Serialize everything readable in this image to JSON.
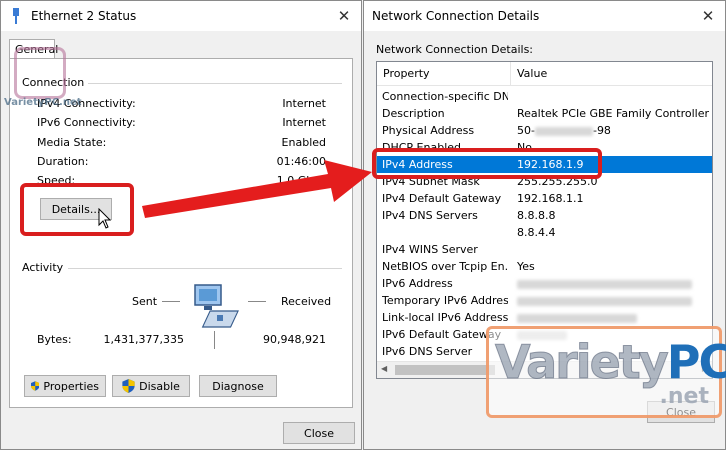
{
  "left_window": {
    "title": "Ethernet 2 Status",
    "tab_general": "General",
    "connection_group": "Connection",
    "rows": [
      {
        "label": "IPv4 Connectivity:",
        "value": "Internet"
      },
      {
        "label": "IPv6 Connectivity:",
        "value": "Internet"
      },
      {
        "label": "Media State:",
        "value": "Enabled"
      },
      {
        "label": "Duration:",
        "value": "01:46:00"
      },
      {
        "label": "Speed:",
        "value": "1.0 Gbps"
      }
    ],
    "details_button": "Details...",
    "activity_group": "Activity",
    "sent_label": "Sent",
    "received_label": "Received",
    "bytes_label": "Bytes:",
    "bytes_sent": "1,431,377,335",
    "bytes_received": "90,948,921",
    "properties_button": "Properties",
    "disable_button": "Disable",
    "diagnose_button": "Diagnose",
    "close_button": "Close"
  },
  "right_window": {
    "title": "Network Connection Details",
    "group_label": "Network Connection Details:",
    "columns": {
      "property": "Property",
      "value": "Value"
    },
    "rows": [
      {
        "property": "Connection-specific DN...",
        "value": ""
      },
      {
        "property": "Description",
        "value": "Realtek PCIe GBE Family Controller"
      },
      {
        "property": "Physical Address",
        "value": "50-",
        "value_suffix": "-98",
        "redacted": true
      },
      {
        "property": "DHCP Enabled",
        "value": "No"
      },
      {
        "property": "IPv4 Address",
        "value": "192.168.1.9",
        "selected": true
      },
      {
        "property": "IPv4 Subnet Mask",
        "value": "255.255.255.0"
      },
      {
        "property": "IPv4 Default Gateway",
        "value": "192.168.1.1"
      },
      {
        "property": "IPv4 DNS Servers",
        "value": "8.8.8.8"
      },
      {
        "property": "",
        "value": "8.8.4.4"
      },
      {
        "property": "IPv4 WINS Server",
        "value": ""
      },
      {
        "property": "NetBIOS over Tcpip En...",
        "value": "Yes"
      },
      {
        "property": "IPv6 Address",
        "value": "",
        "redacted": true
      },
      {
        "property": "Temporary IPv6 Address",
        "value": "",
        "redacted": true
      },
      {
        "property": "Link-local IPv6 Address",
        "value": "",
        "redacted": true
      },
      {
        "property": "IPv6 Default Gateway",
        "value": "",
        "redacted": true
      },
      {
        "property": "IPv6 DNS Server",
        "value": ""
      }
    ],
    "close_button": "Close"
  },
  "watermark": {
    "main_a": "Variety",
    "main_b": "PC",
    "suffix": ".net",
    "small": "VarietyPC.net"
  },
  "colors": {
    "selection": "#0078d7",
    "annotation": "#d91e1e",
    "shield_blue": "#1f5fbf",
    "shield_yellow": "#f4c400"
  }
}
